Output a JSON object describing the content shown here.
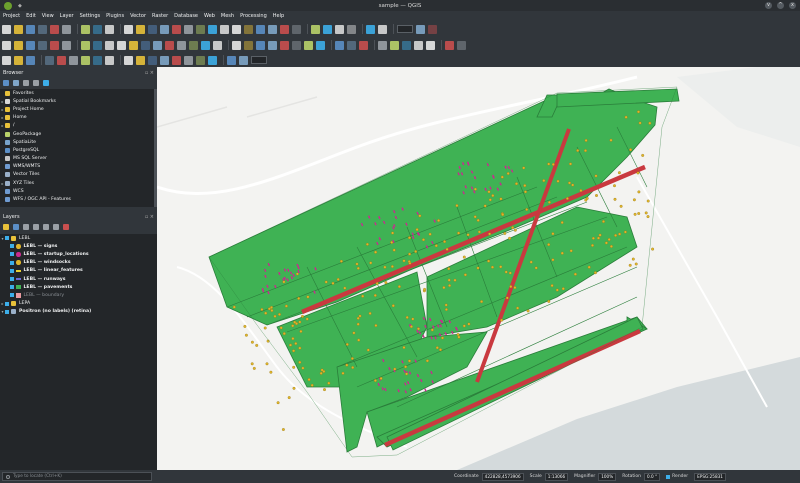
{
  "window": {
    "title": "sample — QGIS",
    "pin_glyph": "◆",
    "buttons": [
      "v",
      "^",
      "x"
    ]
  },
  "menu": [
    "Project",
    "Edit",
    "View",
    "Layer",
    "Settings",
    "Plugins",
    "Vector",
    "Raster",
    "Database",
    "Web",
    "Mesh",
    "Processing",
    "Help"
  ],
  "browser": {
    "title": "Browser",
    "items": [
      {
        "label": "Favorites",
        "icon": "star-icon",
        "color": "#e8c13a",
        "caret": ""
      },
      {
        "label": "Spatial Bookmarks",
        "icon": "bookmark-icon",
        "color": "#d8d8d8",
        "caret": "▸"
      },
      {
        "label": "Project Home",
        "icon": "folder-icon",
        "color": "#e8c13a",
        "caret": "▸"
      },
      {
        "label": "Home",
        "icon": "folder-icon",
        "color": "#e8c13a",
        "caret": "▸"
      },
      {
        "label": "/",
        "icon": "folder-icon",
        "color": "#e8c13a",
        "caret": "▸"
      },
      {
        "label": "GeoPackage",
        "icon": "geopackage-icon",
        "color": "#b9d26a",
        "caret": ""
      },
      {
        "label": "SpatiaLite",
        "icon": "spatialite-icon",
        "color": "#78a4cc",
        "caret": ""
      },
      {
        "label": "PostgreSQL",
        "icon": "postgresql-icon",
        "color": "#5b8fc7",
        "caret": ""
      },
      {
        "label": "MS SQL Server",
        "icon": "mssql-icon",
        "color": "#c7c7c7",
        "caret": ""
      },
      {
        "label": "WMS/WMTS",
        "icon": "wms-icon",
        "color": "#6f9bd1",
        "caret": ""
      },
      {
        "label": "Vector Tiles",
        "icon": "vector-tiles-icon",
        "color": "#9ab0c9",
        "caret": ""
      },
      {
        "label": "XYZ Tiles",
        "icon": "xyz-tiles-icon",
        "color": "#9ab0c9",
        "caret": "▸"
      },
      {
        "label": "WCS",
        "icon": "wcs-icon",
        "color": "#6f9bd1",
        "caret": ""
      },
      {
        "label": "WFS / OGC API - Features",
        "icon": "wfs-icon",
        "color": "#6f9bd1",
        "caret": ""
      }
    ]
  },
  "layers": {
    "title": "Layers",
    "group": "LEBL",
    "items": [
      {
        "label": "LEBL — signs",
        "type": "point",
        "color": "#e0b52a",
        "bold": true
      },
      {
        "label": "LEBL — startup_locations",
        "type": "point",
        "color": "#c92b8f",
        "bold": true
      },
      {
        "label": "LEBL — windsocks",
        "type": "point",
        "color": "#e0b52a",
        "bold": true
      },
      {
        "label": "LEBL — linear_features",
        "type": "line",
        "color": "#e8d032",
        "bold": true
      },
      {
        "label": "LEBL — runways",
        "type": "line",
        "color": "#6b6bd8",
        "bold": true
      },
      {
        "label": "LEBL — pavements",
        "type": "fill",
        "color": "#3fb254",
        "bold": true
      },
      {
        "label": "LEBL — boundary",
        "type": "fill",
        "color": "#e99aa0",
        "bold": false
      }
    ],
    "extra": [
      {
        "label": "LEPA",
        "type": "group"
      },
      {
        "label": "Positron (no labels) (retina)",
        "type": "basemap"
      }
    ]
  },
  "status": {
    "locator_placeholder": "Type to locate (Ctrl+K)",
    "coordinate_label": "Coordinate",
    "coordinate_value": "422828,4573906",
    "scale_label": "Scale",
    "scale_value": "1:13066",
    "magnifier_label": "Magnifier",
    "magnifier_value": "100%",
    "rotation_label": "Rotation",
    "rotation_value": "0.0 °",
    "render_label": "Render",
    "crs_value": "EPSG:25831"
  },
  "colors": {
    "pavement": "#3fb254",
    "pavement_edge": "#2a7d3a",
    "runway": "#c9393f",
    "sign": "#e0b52a",
    "startup": "#c92b8f",
    "basemap": "#f3f3f1",
    "water": "#d4dadc",
    "road": "#ffffff"
  }
}
